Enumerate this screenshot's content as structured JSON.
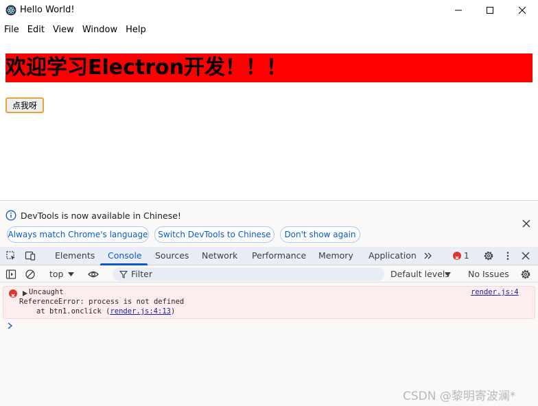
{
  "window": {
    "title": "Hello World!",
    "icon": "electron-icon",
    "controls": [
      "minimize-icon",
      "maximize-icon",
      "close-icon"
    ]
  },
  "menubar": {
    "items": [
      "File",
      "Edit",
      "View",
      "Window",
      "Help"
    ]
  },
  "page": {
    "headline": "欢迎学习Electron开发！！！",
    "button_label": "点我呀",
    "headline_bg": "#ff0000",
    "button_border": "#e8a33a"
  },
  "devtools": {
    "infobar": {
      "message": "DevTools is now available in Chinese!",
      "buttons": [
        "Always match Chrome's language",
        "Switch DevTools to Chinese",
        "Don't show again"
      ]
    },
    "tabs": [
      "Elements",
      "Console",
      "Sources",
      "Network",
      "Performance",
      "Memory",
      "Application"
    ],
    "active_tab": "Console",
    "error_count": "1",
    "toolbar": {
      "context": "top",
      "filter_placeholder": "Filter",
      "levels": "Default levels",
      "issues": "No Issues"
    },
    "console": {
      "line1": "Uncaught",
      "line2": "ReferenceError: process is not defined",
      "line3_prefix": "at btn1.onclick (",
      "line3_link": "render.js:4:13",
      "line3_suffix": ")",
      "source_link": "render.js:4"
    },
    "accent": "#0b57d0",
    "error_color": "#dc362e"
  },
  "watermark": "CSDN @黎明寄波澜*"
}
